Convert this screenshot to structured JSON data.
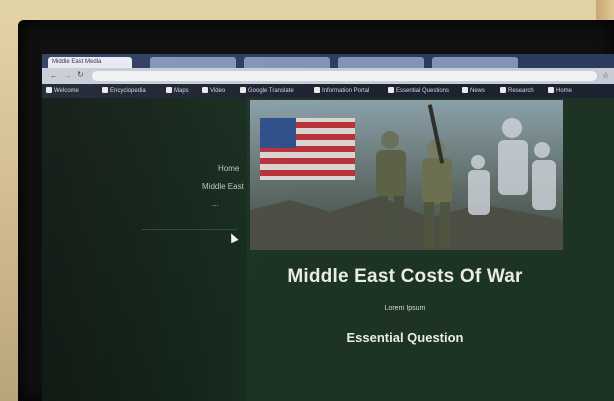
{
  "browser": {
    "tabs": [
      {
        "label": "Middle East Media"
      },
      {
        "label": ""
      },
      {
        "label": ""
      },
      {
        "label": ""
      },
      {
        "label": ""
      }
    ],
    "address": "",
    "bookmarks": [
      {
        "label": "Welcome"
      },
      {
        "label": "Encyclopedia"
      },
      {
        "label": "Maps"
      },
      {
        "label": "Video"
      },
      {
        "label": "Google Translate"
      },
      {
        "label": "Information Portal"
      },
      {
        "label": "Essential Questions"
      },
      {
        "label": "News"
      },
      {
        "label": "Research"
      },
      {
        "label": "Home"
      }
    ]
  },
  "sidebar": {
    "links": [
      {
        "label": "Home"
      },
      {
        "label": "Middle East"
      },
      {
        "label": "..."
      }
    ]
  },
  "page": {
    "title": "Middle East Costs Of War",
    "subtitle": "Lorem Ipsum",
    "section_heading": "Essential Question",
    "paragraph": "",
    "hero_alt": "Soldiers in front of US flag"
  },
  "colors": {
    "page_bg": "#1d3324",
    "sidebar_bg": "#0b140e",
    "title_text": "#e8ece4",
    "browser_tabbar": "#2b3b5e"
  }
}
